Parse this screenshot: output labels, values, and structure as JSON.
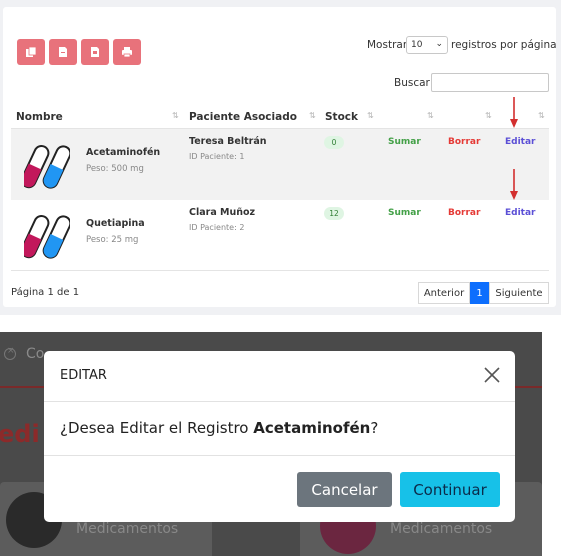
{
  "toolbar": {
    "buttons": [
      {
        "icon": "copy-icon",
        "color": "#e8727b"
      },
      {
        "icon": "csv-icon",
        "color": "#e8727b"
      },
      {
        "icon": "excel-icon",
        "color": "#e8727b"
      },
      {
        "icon": "print-icon",
        "color": "#e8727b"
      }
    ]
  },
  "length_menu": {
    "prefix": "Mostrar",
    "value": "10",
    "suffix": "registros por página"
  },
  "search": {
    "label": "Buscar",
    "value": ""
  },
  "table": {
    "headers": [
      "Nombre",
      "Paciente Asociado",
      "Stock"
    ],
    "rows": [
      {
        "name": "Acetaminofén",
        "dose": "Peso: 500 mg",
        "patient": "Teresa Beltrán",
        "patient_id": "ID Paciente: 1",
        "stock": "0",
        "sumar": "Sumar",
        "borrar": "Borrar",
        "editar": "Editar"
      },
      {
        "name": "Quetiapina",
        "dose": "Peso: 25 mg",
        "patient": "Clara Muñoz",
        "patient_id": "ID Paciente: 2",
        "stock": "12",
        "sumar": "Sumar",
        "borrar": "Borrar",
        "editar": "Editar"
      }
    ]
  },
  "pagination": {
    "info": "Página 1 de 1",
    "prev": "Anterior",
    "current": "1",
    "next": "Siguiente"
  },
  "background": {
    "top_text": "Co...",
    "title": "edi",
    "tile1_text": "Medicamentos",
    "tile2_text": "Medicamentos"
  },
  "modal": {
    "title": "EDITAR",
    "body_prefix": "¿Desea Editar el Registro ",
    "body_item": "Acetaminofén",
    "body_suffix": "?",
    "cancel_label": "Cancelar",
    "continue_label": "Continuar"
  },
  "colors": {
    "export_button": "#e8727b",
    "continue_button": "#17c1e8",
    "cancel_button": "#6c757d",
    "pagination_active": "#0d6efd",
    "annotation_arrow": "#d32f2f"
  }
}
